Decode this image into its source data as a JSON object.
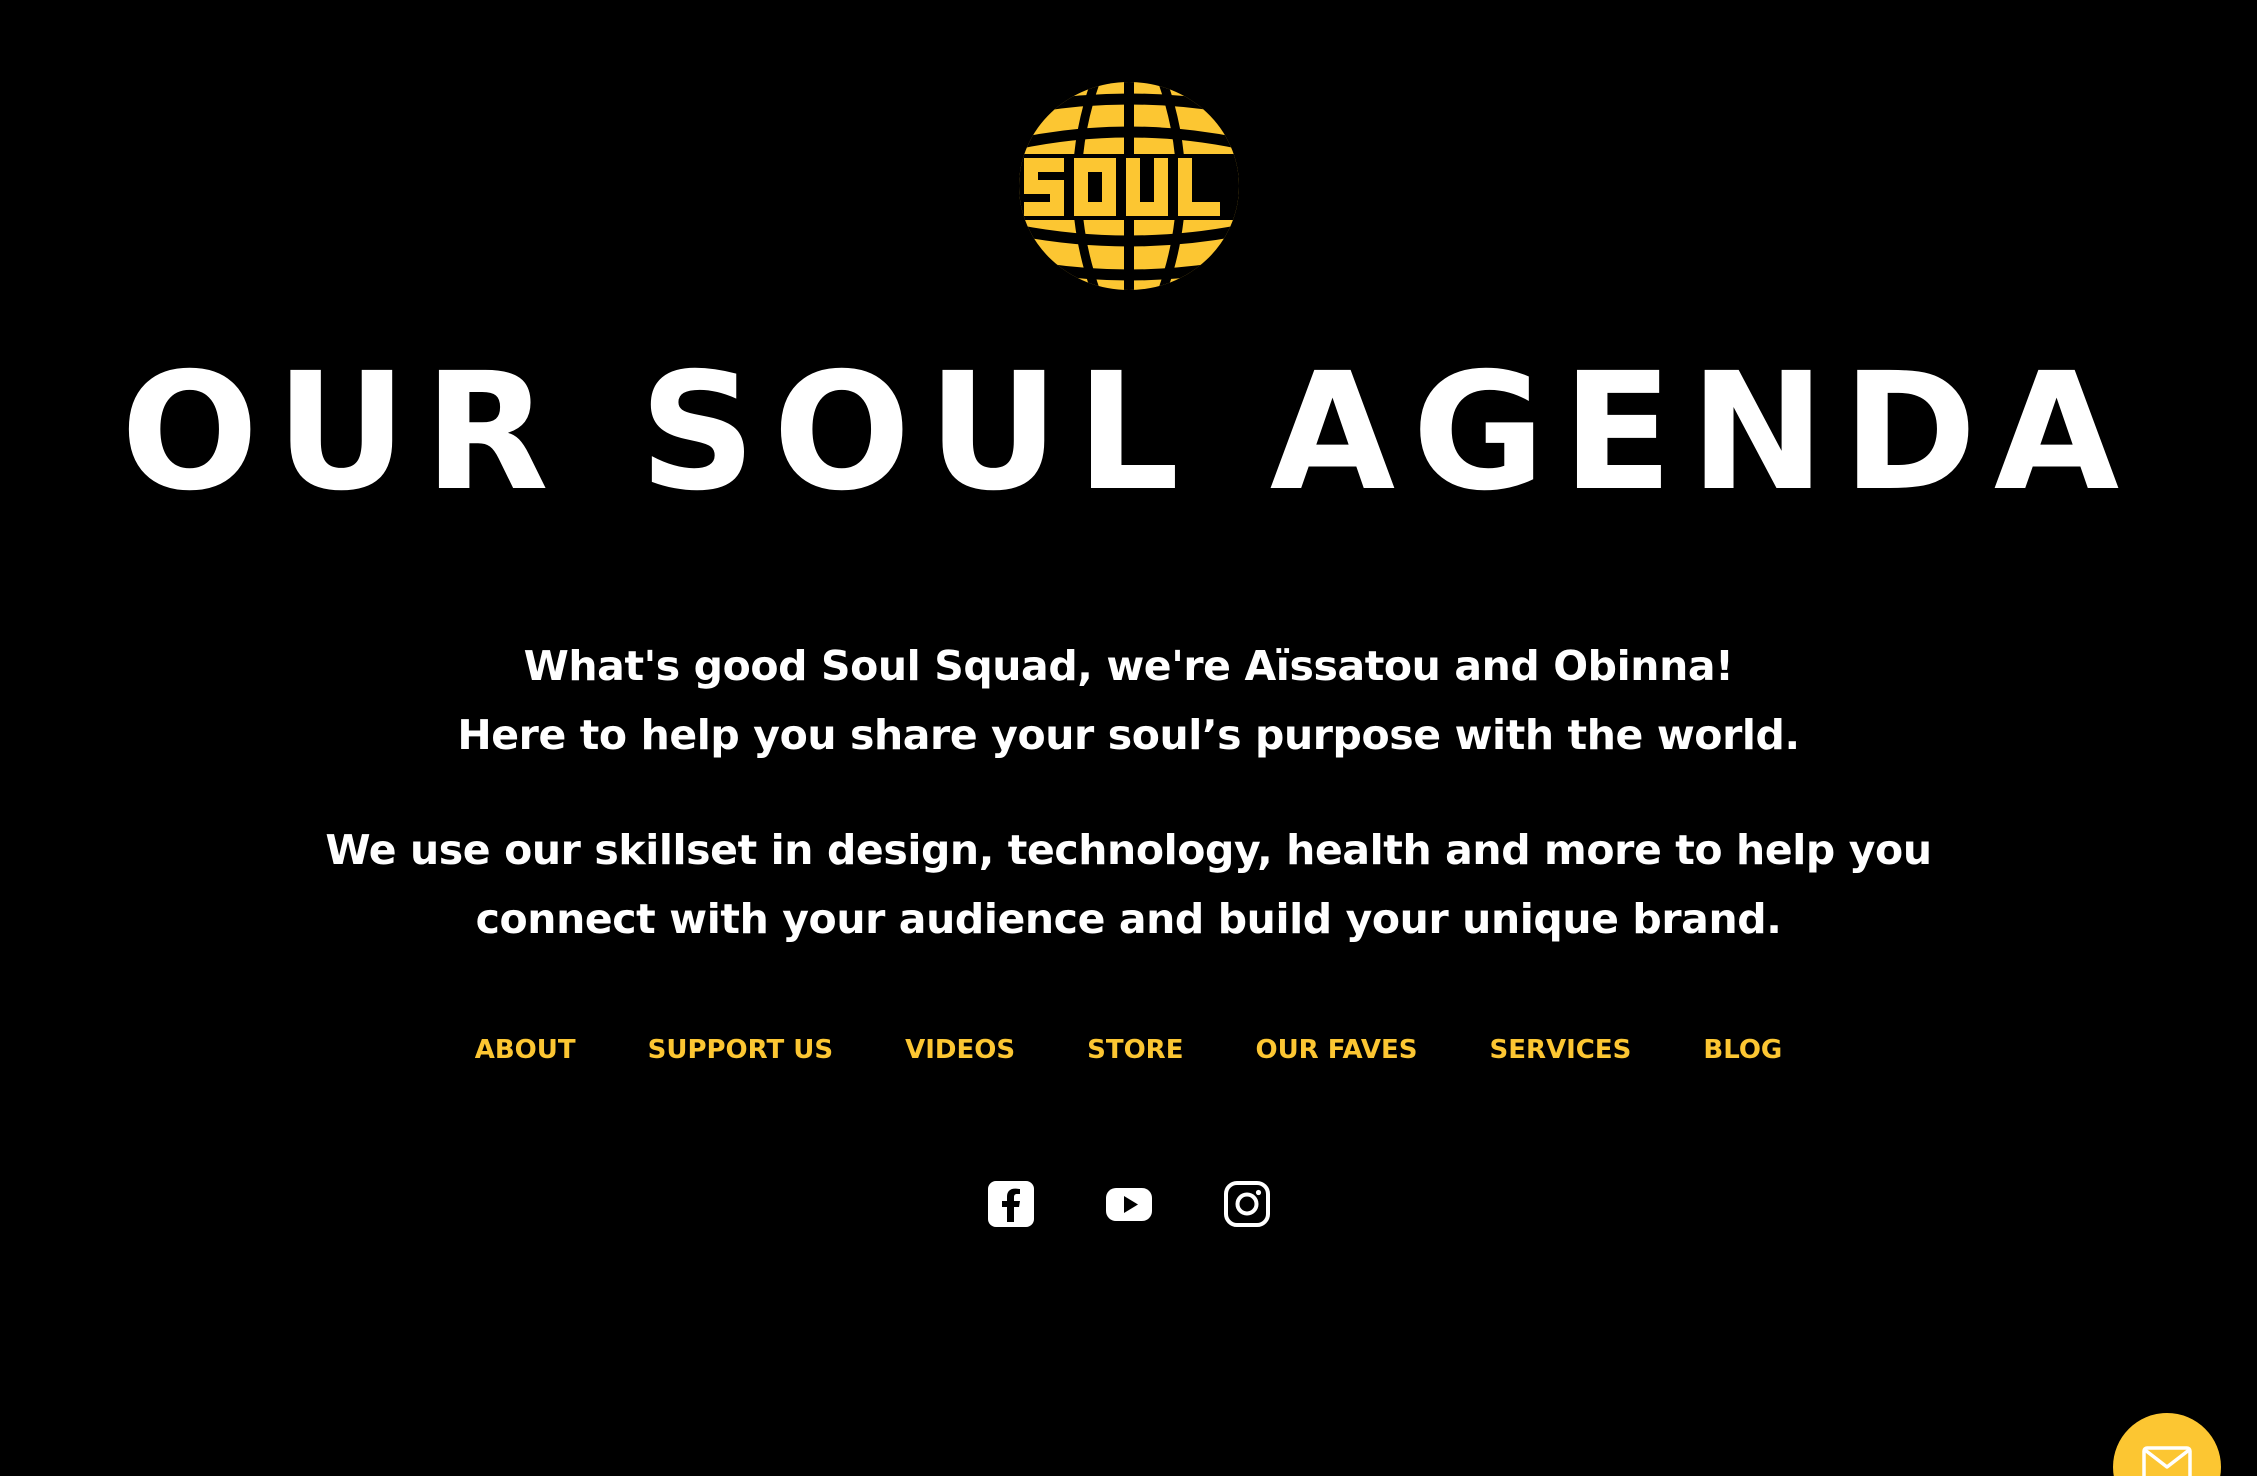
{
  "brand": {
    "logo_text": "SOUL",
    "accent_color": "#fcc632",
    "background_color": "#000000",
    "text_color": "#ffffff"
  },
  "hero": {
    "title": "OUR SOUL AGENDA"
  },
  "intro": {
    "line1": "What's good Soul Squad, we're Aïssatou and Obinna!",
    "line2": "Here to help you share your soul’s purpose with the world.",
    "line3": "We use our skillset in design, technology, health and more to help you",
    "line4": "connect with your audience and build your unique brand."
  },
  "nav": {
    "items": [
      {
        "label": "ABOUT"
      },
      {
        "label": "SUPPORT US"
      },
      {
        "label": "VIDEOS"
      },
      {
        "label": "STORE"
      },
      {
        "label": "OUR FAVES"
      },
      {
        "label": "SERVICES"
      },
      {
        "label": "BLOG"
      }
    ]
  },
  "social": {
    "icons": [
      "facebook-icon",
      "youtube-icon",
      "instagram-icon"
    ]
  },
  "contact": {
    "icon": "mail-icon"
  }
}
